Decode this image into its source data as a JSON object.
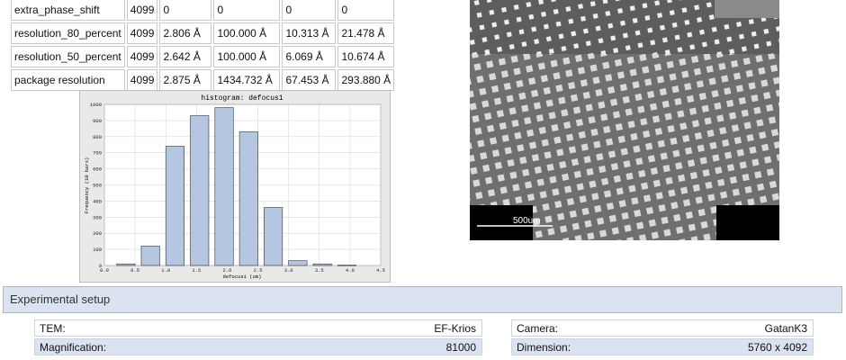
{
  "stats_table": {
    "rows": [
      {
        "label": "extra_phase_shift",
        "count": "4099",
        "min": "0",
        "max": "0",
        "mean": "0",
        "std": "0"
      },
      {
        "label": "resolution_80_percent",
        "count": "4099",
        "min": "2.806 Å",
        "max": "100.000 Å",
        "mean": "10.313 Å",
        "std": "21.478 Å"
      },
      {
        "label": "resolution_50_percent",
        "count": "4099",
        "min": "2.642 Å",
        "max": "100.000 Å",
        "mean": "6.069 Å",
        "std": "10.674 Å"
      },
      {
        "label": "package resolution",
        "count": "4099",
        "min": "2.875 Å",
        "max": "1434.732 Å",
        "mean": "67.453 Å",
        "std": "293.880 Å"
      }
    ]
  },
  "chart_data": {
    "type": "bar",
    "title": "histogram: defocus1",
    "xlabel": "defocus1 (um)",
    "ylabel": "Frequency (10 bars)",
    "xlim": [
      0.0,
      4.5
    ],
    "ylim": [
      0,
      1000
    ],
    "xticks": [
      "0.0",
      "0.5",
      "1.0",
      "1.5",
      "2.0",
      "2.5",
      "3.0",
      "3.5",
      "4.0",
      "4.5"
    ],
    "yticks": [
      "0",
      "100",
      "200",
      "300",
      "400",
      "500",
      "600",
      "700",
      "800",
      "900",
      "1000"
    ],
    "bins": [
      {
        "x0": 0.2,
        "x1": 0.5,
        "value": 10
      },
      {
        "x0": 0.6,
        "x1": 0.9,
        "value": 120
      },
      {
        "x0": 1.0,
        "x1": 1.3,
        "value": 740
      },
      {
        "x0": 1.4,
        "x1": 1.7,
        "value": 930
      },
      {
        "x0": 1.8,
        "x1": 2.1,
        "value": 980
      },
      {
        "x0": 2.2,
        "x1": 2.5,
        "value": 830
      },
      {
        "x0": 2.6,
        "x1": 2.9,
        "value": 360
      },
      {
        "x0": 3.0,
        "x1": 3.3,
        "value": 30
      },
      {
        "x0": 3.4,
        "x1": 3.7,
        "value": 10
      },
      {
        "x0": 3.8,
        "x1": 4.1,
        "value": 2
      }
    ],
    "grid": true,
    "bar_color": "#b4c6e0"
  },
  "micrograph": {
    "scale_label": "500um"
  },
  "section": {
    "title": "Experimental setup"
  },
  "setup_left": [
    {
      "label": "TEM:",
      "value": "EF-Krios"
    },
    {
      "label": "Magnification:",
      "value": "81000"
    }
  ],
  "setup_right": [
    {
      "label": "Camera:",
      "value": "GatanK3"
    },
    {
      "label": "Dimension:",
      "value": "5760 x 4092"
    }
  ]
}
